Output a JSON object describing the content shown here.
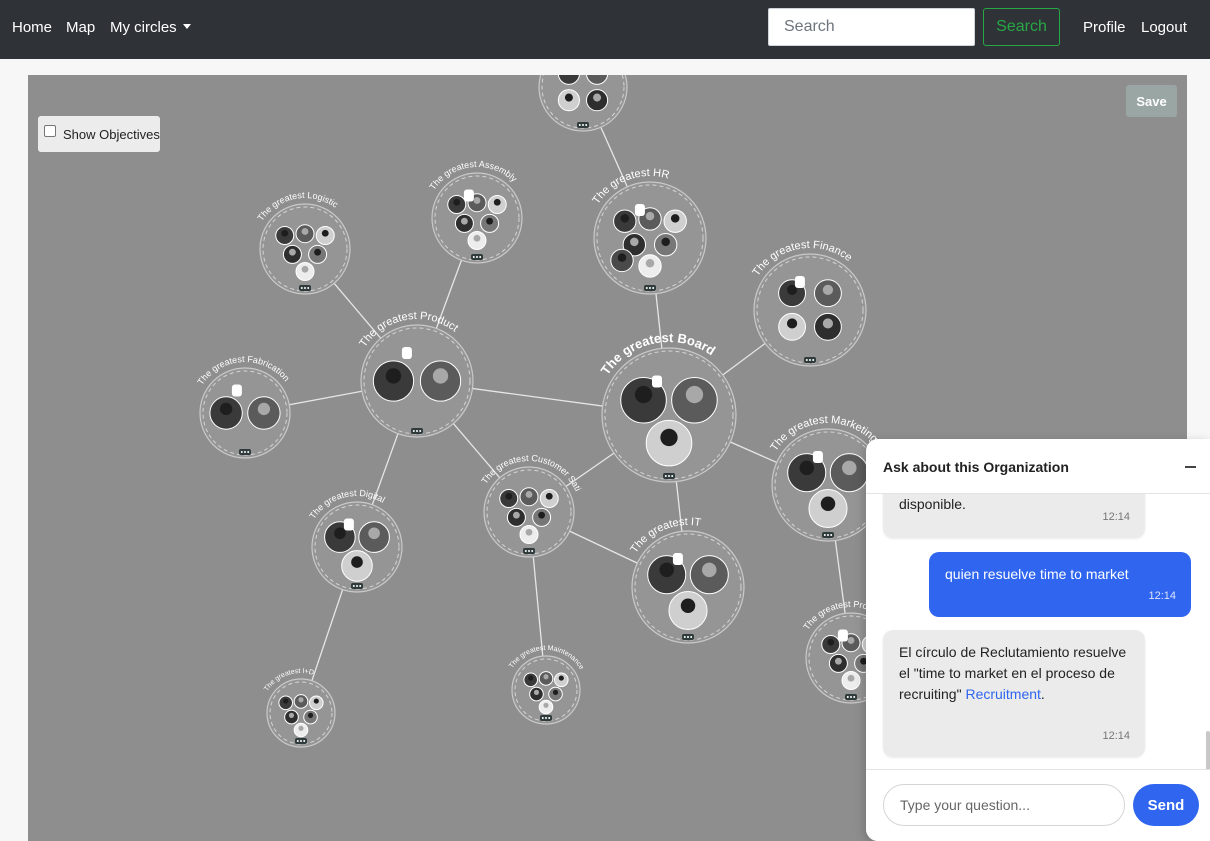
{
  "nav": {
    "home": "Home",
    "map": "Map",
    "my_circles": "My circles",
    "search_placeholder": "Search",
    "search_button": "Search",
    "profile": "Profile",
    "logout": "Logout"
  },
  "map": {
    "show_objectives": "Show Objectives",
    "save": "Save",
    "circles": [
      {
        "id": "top",
        "label": ""
      },
      {
        "id": "logistic",
        "label": "The greatest Logistic"
      },
      {
        "id": "assembly",
        "label": "The greatest Assembly"
      },
      {
        "id": "hr",
        "label": "The greatest HR"
      },
      {
        "id": "finance",
        "label": "The greatest Finance"
      },
      {
        "id": "product",
        "label": "The greatest Product"
      },
      {
        "id": "board",
        "label": "The greatest Board"
      },
      {
        "id": "fabrication",
        "label": "The greatest Fabrication"
      },
      {
        "id": "marketing",
        "label": "The greatest Marketing"
      },
      {
        "id": "custsat",
        "label": "The greatest Customer Satisfaction"
      },
      {
        "id": "digital",
        "label": "The greatest Digital"
      },
      {
        "id": "it",
        "label": "The greatest IT"
      },
      {
        "id": "id",
        "label": "The greatest I+D"
      },
      {
        "id": "maintenance",
        "label": "The greatest Maintenance"
      },
      {
        "id": "prototypes",
        "label": "The greatest Prototy"
      }
    ]
  },
  "chat": {
    "title": "Ask about this Organization",
    "messages": [
      {
        "role": "bot",
        "text": "disponible.",
        "time": "12:14"
      },
      {
        "role": "user",
        "text": "quien resuelve time to market",
        "time": "12:14"
      },
      {
        "role": "bot",
        "text": "El círculo de Reclutamiento resuelve el \"time to market en el proceso de recruiting\"",
        "link": "Recruitment",
        "after_link": ".",
        "time": "12:14"
      }
    ],
    "input_placeholder": "Type your question...",
    "send": "Send"
  },
  "colors": {
    "navbar": "#2f3337",
    "canvas": "#8e8e8e",
    "accent_blue": "#2f65ef",
    "search_green": "#28a745"
  }
}
